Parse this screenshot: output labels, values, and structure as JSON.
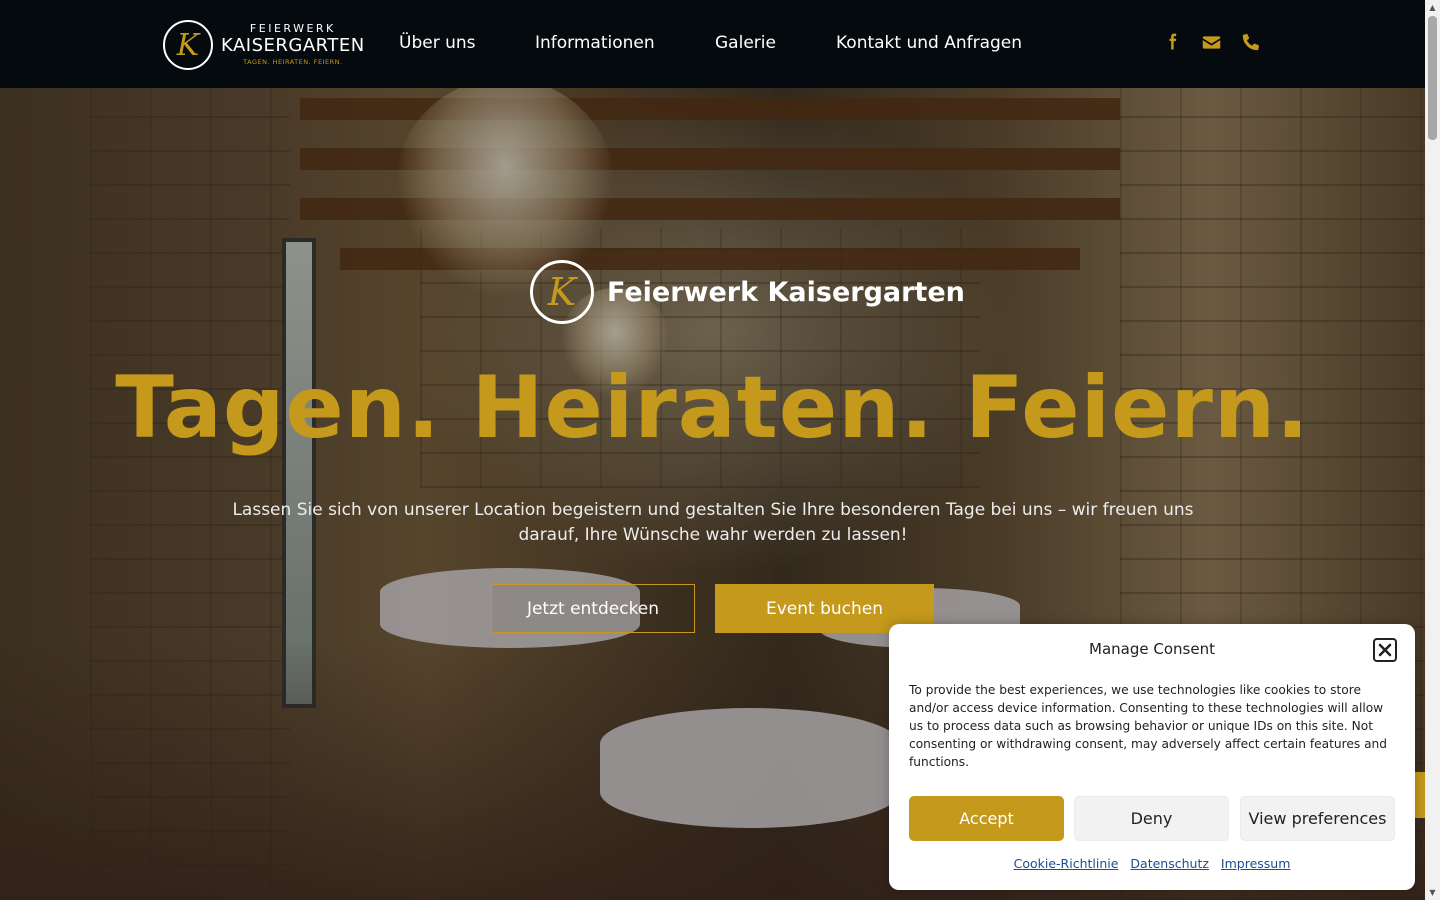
{
  "colors": {
    "accent": "#c4991c",
    "header_bg": "#050a0e",
    "text_light": "#ffffff"
  },
  "logo": {
    "top_text": "FEIERWERK",
    "main_text": "KAISERGARTEN",
    "tagline": "TAGEN. HEIRATEN. FEIERN.",
    "monogram": "K"
  },
  "nav": {
    "items": [
      "Über uns",
      "Informationen",
      "Galerie",
      "Kontakt und Anfragen"
    ]
  },
  "social": {
    "icons": [
      "facebook-icon",
      "envelope-icon",
      "phone-icon"
    ]
  },
  "hero": {
    "brand_monogram": "K",
    "brand_name": "Feierwerk Kaisergarten",
    "title": "Tagen. Heiraten. Feiern.",
    "subtitle": "Lassen Sie sich von unserer Location begeistern und gestalten Sie Ihre besonderen Tage bei uns – wir freuen uns darauf, Ihre Wünsche wahr werden zu lassen!",
    "button_discover": "Jetzt entdecken",
    "button_book": "Event buchen"
  },
  "consent": {
    "title": "Manage Consent",
    "text": "To provide the best experiences, we use technologies like cookies to store and/or access device information. Consenting to these technologies will allow us to process data such as browsing behavior or unique IDs on this site. Not consenting or withdrawing consent, may adversely affect certain features and functions.",
    "accept": "Accept",
    "deny": "Deny",
    "preferences": "View preferences",
    "links": [
      "Cookie-Richtlinie",
      "Datenschutz",
      "Impressum"
    ]
  }
}
